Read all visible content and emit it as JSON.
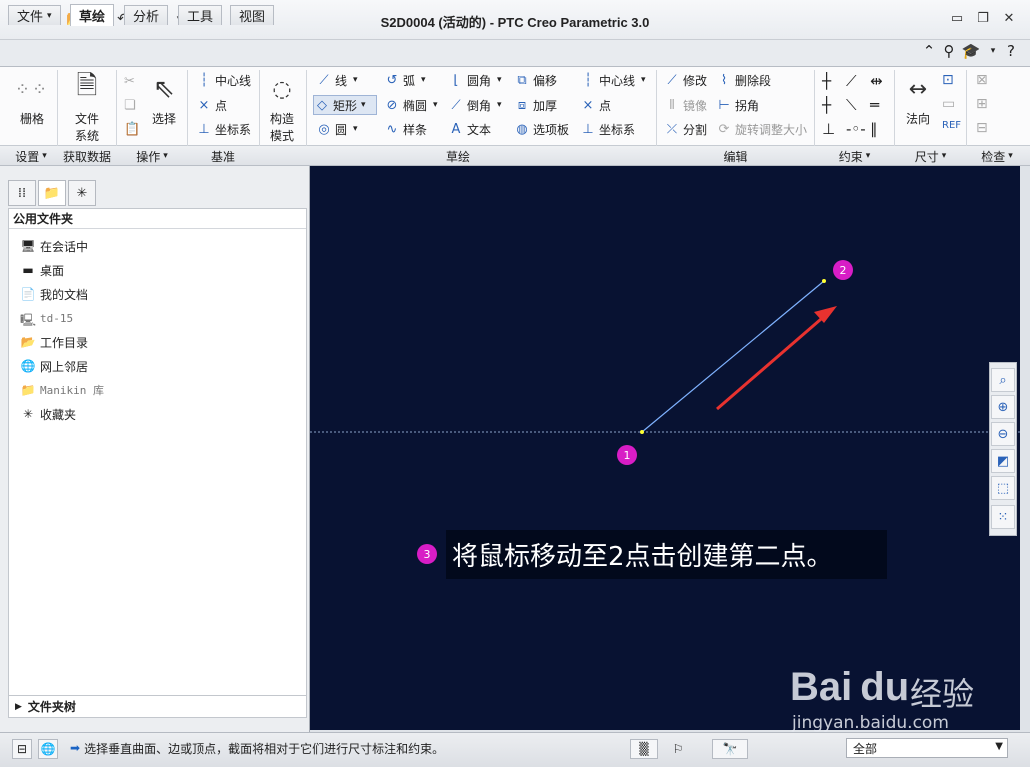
{
  "window": {
    "title": "S2D0004 (活动的) - PTC Creo Parametric 3.0",
    "minimize_icon": "minimize-icon",
    "restore_icon": "restore-icon",
    "close_icon": "close-icon"
  },
  "tabs": [
    {
      "label": "文件",
      "has_dropdown": true
    },
    {
      "label": "草绘",
      "active": true
    },
    {
      "label": "分析"
    },
    {
      "label": "工具"
    },
    {
      "label": "视图"
    }
  ],
  "ribbon": {
    "settings": {
      "grid_label": "栅格"
    },
    "get_data": {
      "file_system_label": "文件\n系统",
      "file_system_line1": "文件",
      "file_system_line2": "系统"
    },
    "operations": {
      "select_label": "选择"
    },
    "datum": {
      "centerline": "中心线",
      "point": "点",
      "coord_sys": "坐标系"
    },
    "construction": {
      "line1": "构造",
      "line2": "模式"
    },
    "sketch": {
      "line": "线",
      "rectangle": "矩形",
      "circle": "圆",
      "arc": "弧",
      "ellipse": "椭圆",
      "spline": "样条",
      "fillet": "圆角",
      "chamfer": "倒角",
      "text": "文本",
      "offset": "偏移",
      "thicken": "加厚",
      "palette": "选项板",
      "centerline": "中心线",
      "point": "点",
      "coord_sys": "坐标系"
    },
    "edit": {
      "modify": "修改",
      "delete_segment": "删除段",
      "mirror": "镜像",
      "corner": "拐角",
      "divide": "分割",
      "rotate_resize": "旋转调整大小"
    },
    "dimension": {
      "normal": "法向"
    },
    "groups": {
      "settings": "设置",
      "get_data": "获取数据",
      "operations": "操作",
      "datum": "基准",
      "sketch": "草绘",
      "edit": "编辑",
      "constrain": "约束",
      "dimension": "尺寸",
      "inspect": "检查"
    }
  },
  "left_panel": {
    "header": "公用文件夹",
    "items": [
      {
        "label": "在会话中",
        "icon": "monitor-icon"
      },
      {
        "label": "桌面",
        "icon": "desktop-icon"
      },
      {
        "label": "我的文档",
        "icon": "documents-icon"
      },
      {
        "label": "td-15",
        "icon": "computer-icon"
      },
      {
        "label": "工作目录",
        "icon": "working-folder-icon"
      },
      {
        "label": "网上邻居",
        "icon": "network-icon"
      },
      {
        "label": "Manikin 库",
        "icon": "library-icon"
      },
      {
        "label": "收藏夹",
        "icon": "favorites-icon"
      }
    ],
    "tree_label": "文件夹树"
  },
  "canvas": {
    "background": "#081232",
    "markers": [
      "1",
      "2",
      "3"
    ],
    "tip": "将鼠标移动至2点击创建第二点。"
  },
  "watermark": {
    "logo": "Bai du",
    "cn": "经验",
    "url": "jingyan.baidu.com"
  },
  "statusbar": {
    "message": "选择垂直曲面、边或顶点，截面将相对于它们进行尺寸标注和约束。",
    "filter_value": "全部"
  }
}
